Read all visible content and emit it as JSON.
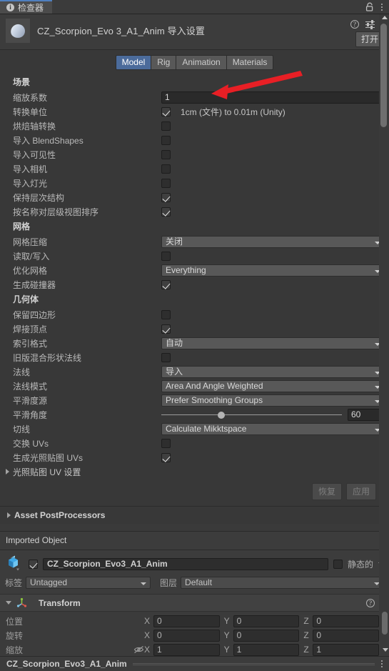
{
  "window": {
    "tab_label": "检查器",
    "tab_icon": "info-icon",
    "lock_icon": "lock-icon",
    "menu_icon": "kebab-menu-icon"
  },
  "header": {
    "title": "CZ_Scorpion_Evo 3_A1_Anim 导入设置",
    "open_button": "打开",
    "help_icon": "help-icon",
    "preset_icon": "preset-settings-icon",
    "menu_icon": "kebab-menu-icon"
  },
  "importer_tabs": [
    {
      "label": "Model",
      "selected": true
    },
    {
      "label": "Rig",
      "selected": false
    },
    {
      "label": "Animation",
      "selected": false
    },
    {
      "label": "Materials",
      "selected": false
    }
  ],
  "sections": {
    "scene": {
      "title": "场景",
      "scale_factor": {
        "label": "缩放系数",
        "value": "1"
      },
      "convert_units": {
        "label": "转换单位",
        "checked": true,
        "note": "1cm (文件) to 0.01m (Unity)"
      },
      "bake_axis": {
        "label": "烘焙轴转换",
        "checked": false
      },
      "import_blendshapes": {
        "label": "导入 BlendShapes",
        "checked": false
      },
      "import_visibility": {
        "label": "导入可见性",
        "checked": false
      },
      "import_cameras": {
        "label": "导入相机",
        "checked": false
      },
      "import_lights": {
        "label": "导入灯光",
        "checked": false
      },
      "preserve_hierarchy": {
        "label": "保持层次结构",
        "checked": true
      },
      "sort_hierarchy": {
        "label": "按名称对层级视图排序",
        "checked": true
      }
    },
    "mesh": {
      "title": "网格",
      "mesh_compression": {
        "label": "网格压缩",
        "value": "关闭"
      },
      "read_write": {
        "label": "读取/写入",
        "checked": false
      },
      "optimize_mesh": {
        "label": "优化网格",
        "value": "Everything"
      },
      "generate_colliders": {
        "label": "生成碰撞器",
        "checked": true
      }
    },
    "geometry": {
      "title": "几何体",
      "keep_quads": {
        "label": "保留四边形",
        "checked": false
      },
      "weld_vertices": {
        "label": "焊接顶点",
        "checked": true
      },
      "index_format": {
        "label": "索引格式",
        "value": "自动"
      },
      "legacy_blendshape_normals": {
        "label": "旧版混合形状法线",
        "checked": false
      },
      "normals": {
        "label": "法线",
        "value": "导入"
      },
      "normals_mode": {
        "label": "法线模式",
        "value": "Area And Angle Weighted"
      },
      "smoothness_source": {
        "label": "平滑度源",
        "value": "Prefer Smoothing Groups"
      },
      "smoothing_angle": {
        "label": "平滑角度",
        "value": "60",
        "min": 0,
        "max": 180
      },
      "tangents": {
        "label": "切线",
        "value": "Calculate Mikktspace"
      },
      "swap_uvs": {
        "label": "交换 UVs",
        "checked": false
      },
      "generate_lightmap_uvs": {
        "label": "生成光照贴图 UVs",
        "checked": true
      },
      "lightmap_uv_settings": {
        "label": "光照贴图 UV 设置",
        "expanded": false
      }
    }
  },
  "actions": {
    "revert": "恢复",
    "apply": "应用",
    "disabled": true
  },
  "asset_postprocessors": {
    "label": "Asset PostProcessors",
    "expanded": false
  },
  "imported_object": {
    "bar_label": "Imported Object",
    "icon": "prefab-icon",
    "enabled": true,
    "name": "CZ_Scorpion_Evo3_A1_Anim",
    "static_label": "静态的",
    "static_checked": false,
    "tag_label": "标签",
    "tag_value": "Untagged",
    "layer_label": "图层",
    "layer_value": "Default"
  },
  "transform": {
    "title": "Transform",
    "expanded": true,
    "icon": "transform-axis-icon",
    "help_icon": "help-icon",
    "menu_icon": "kebab-menu-icon",
    "rows": [
      {
        "label": "位置",
        "x": "0",
        "y": "0",
        "z": "0",
        "locked": false
      },
      {
        "label": "旋转",
        "x": "0",
        "y": "0",
        "z": "0",
        "locked": false
      },
      {
        "label": "缩放",
        "x": "1",
        "y": "1",
        "z": "1",
        "locked": true
      }
    ],
    "axis_x": "X",
    "axis_y": "Y",
    "axis_z": "Z"
  },
  "status_bar": {
    "name": "CZ_Scorpion_Evo3_A1_Anim",
    "menu_icon": "kebab-menu-icon"
  },
  "annotation": {
    "type": "arrow",
    "color": "#e81f25",
    "points_to": "scale-factor-input"
  },
  "colors": {
    "accent_blue": "#4b6b9b",
    "panel_bg": "#383838",
    "header_bg": "#3c3c3c",
    "annotation_red": "#e81f25"
  }
}
